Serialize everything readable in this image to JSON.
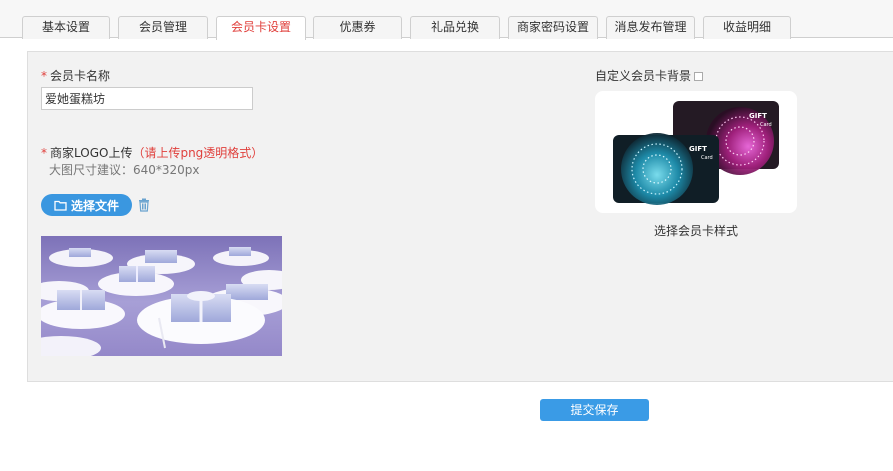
{
  "tabs": [
    {
      "label": "基本设置",
      "active": false
    },
    {
      "label": "会员管理",
      "active": false
    },
    {
      "label": "会员卡设置",
      "active": true
    },
    {
      "label": "优惠券",
      "active": false
    },
    {
      "label": "礼品兑换",
      "active": false
    },
    {
      "label": "商家密码设置",
      "active": false
    },
    {
      "label": "消息发布管理",
      "active": false
    },
    {
      "label": "收益明细",
      "active": false
    }
  ],
  "form": {
    "required_mark": "*",
    "card_name_label": "会员卡名称",
    "card_name_value": "爱她蛋糕坊",
    "logo_label": "商家LOGO上传",
    "logo_hint": "（请上传png透明格式）",
    "size_hint": "大图尺寸建议：640*320px",
    "choose_file_label": "选择文件",
    "custom_bg_label": "自定义会员卡背景",
    "card_style_caption": "选择会员卡样式",
    "card_text_gift": "GIFT",
    "card_text_card": "Card"
  },
  "submit_label": "提交保存",
  "colors": {
    "accent_red": "#e0403c",
    "button_blue": "#3a97e0",
    "panel_bg": "#f2f2f2"
  }
}
